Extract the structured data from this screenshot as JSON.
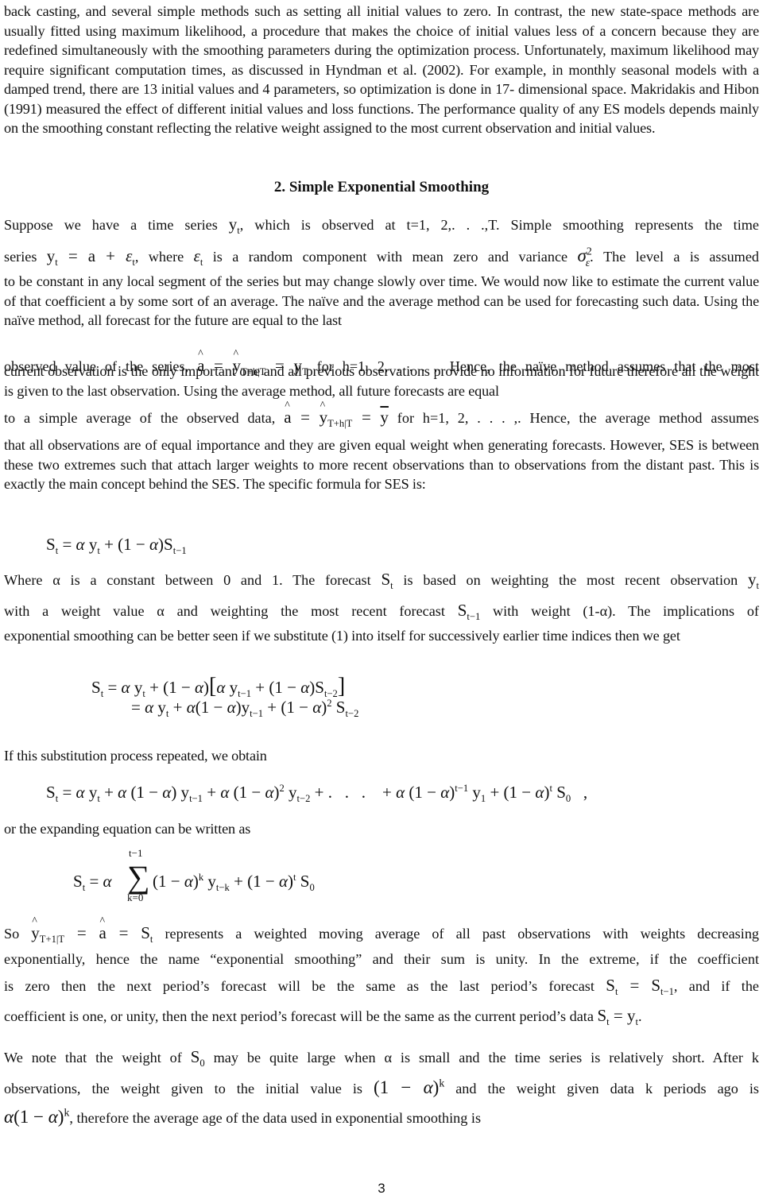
{
  "paragraph_intro": "back casting, and several simple methods such as setting all initial values to zero. In contrast, the new state-space methods are usually fitted using maximum likelihood, a procedure that makes the choice of initial values less of a concern because they are redefined simultaneously with the smoothing parameters during the optimization process. Unfortunately, maximum likelihood may require significant computation times, as discussed in Hyndman et al. (2002). For example, in monthly seasonal models with a damped trend, there are 13 initial values and 4 parameters, so optimization is done in 17- dimensional space. Makridakis and Hibon (1991) measured the effect of different initial values and loss functions. The performance quality of any ES models depends mainly on the smoothing constant reflecting the relative weight assigned to the most current observation and initial values.",
  "section_heading": "2.    Simple Exponential Smoothing",
  "ses": {
    "l1a": "Suppose we have a time series ",
    "l1b": ", which is observed at t=1, 2,. . .,T.  Simple smoothing represents the time",
    "l2a": "series ",
    "l2b": ", where ",
    "l2c": " is a random component with mean zero and variance ",
    "l2d": ". The level a is assumed",
    "p3": "to be constant in any local segment of the series but may change slowly over time. We would now like to estimate the current value of that coefficient a by some sort of an average. The naïve and the average method can be used for forecasting such data. Using the naïve method, all forecast for the future are equal to the last",
    "l4a": "observed value of the series, ",
    "l4b": " for h=1, 2, . . . ,. Hence, the naïve method assumes that the most",
    "p5": "current observation is the only important one and all previous observations provide no information for future therefore all the weight is given to the last observation. Using the average method, all future forecasts are equal",
    "l6a": "to a simple average of the observed data, ",
    "l6b": " for h=1, 2, . . . ,. Hence, the average method assumes",
    "p7": "that all observations are of equal importance and they are given equal weight when generating forecasts. However, SES is between these two extremes such that attach larger weights to more recent observations than to observations from the distant past. This is exactly the main concept behind the SES. The specific formula for SES is:",
    "l8a": "Where α is a constant between 0 and 1. The forecast ",
    "l8b": " is based on weighting the most recent observation ",
    "l9a": "with a weight value α and weighting the most recent forecast ",
    "l9b": " with weight (1-α). The implications of",
    "p10": "exponential smoothing can be better seen if we substitute (1) into itself for successively earlier time indices then we get",
    "p11": "If this substitution process repeated, we obtain",
    "p12": "or the expanding equation can be written as",
    "l13a": "So ",
    "l13b": " represents a weighted moving average of all past observations with weights decreasing",
    "p14": "exponentially, hence the name “exponential smoothing” and their sum is unity. In the extreme, if the coefficient",
    "l15a": "is zero then the next period’s forecast will be the same as the last period’s forecast ",
    "l15b": ", and if the",
    "l16a": "coefficient is one, or unity, then the next period’s forecast will be the same as the current period’s data ",
    "l16b": ".",
    "l17a": "We note that the weight of ",
    "l17b": " may be quite large when α is small and the time series is relatively short. After k",
    "l18a": "observations, the weight given to the initial value is ",
    "l18b": " and the weight given data k periods ago is",
    "l19b": ", therefore the average age of the data used in exponential smoothing is"
  },
  "equations": {
    "eq1": "Sₜ = α yₜ + (1−α)Sₜ₋₁",
    "eq2_line1": "Sₜ = α yₜ + (1−α)[α yₜ₋₁ + (1−α)Sₜ₋₂]",
    "eq2_line2": "= α yₜ + α(1−α)yₜ₋₁ + (1−α)² Sₜ₋₂",
    "eq3": "Sₜ = α yₜ + α(1−α) yₜ₋₁ + α(1−α)² yₜ₋₂ + . . . + α(1−α)ᵗ⁻¹ y₁ + (1−α)ᵗ S₀ ,",
    "eq4": "Sₜ = α Σ_{k=0}^{t−1} (1−α)ᵏ yₜ₋ₖ + (1−α)ᵗ S₀"
  },
  "page_number": "3"
}
